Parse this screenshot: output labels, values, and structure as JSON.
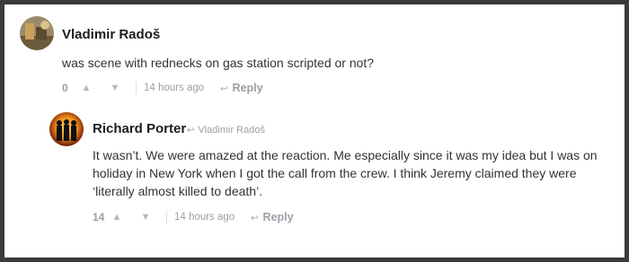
{
  "comments": [
    {
      "author": "Vladimir Radoš",
      "text": "was scene with rednecks on gas station scripted or not?",
      "score": "0",
      "time": "14 hours ago",
      "reply_label": "Reply",
      "upvote_icon": "▲",
      "downvote_icon": "▼",
      "reply_icon": "↩"
    },
    {
      "author": "Richard Porter",
      "reply_to": "Vladimir Radoš",
      "text": "It wasn’t. We were amazed at the reaction. Me especially since it was my idea but I was on holiday in New York when I got the call from the crew. I think Jeremy claimed they were ‘literally almost killed to death’.",
      "score": "14",
      "time": "14 hours ago",
      "reply_label": "Reply",
      "upvote_icon": "▲",
      "downvote_icon": "▼",
      "reply_icon": "↩",
      "reply_to_icon": "↩"
    }
  ]
}
